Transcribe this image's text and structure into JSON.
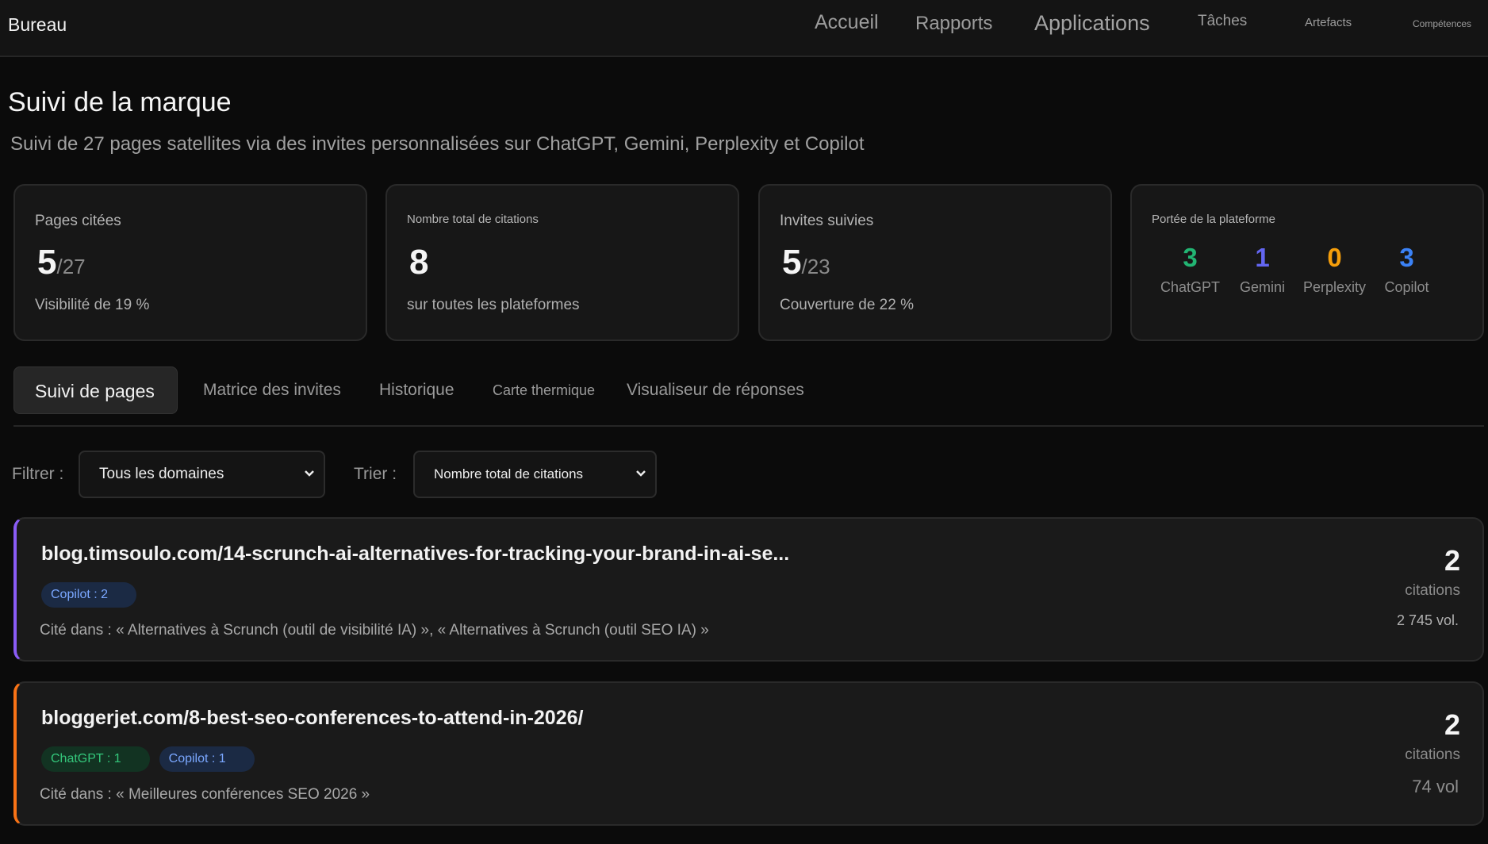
{
  "header": {
    "brand": "Bureau",
    "nav": [
      "Accueil",
      "Rapports",
      "Applications",
      "Tâches",
      "Artefacts",
      "Compétences"
    ]
  },
  "page": {
    "title": "Suivi de la marque",
    "subtitle": "Suivi de 27 pages satellites via des invites personnalisées sur ChatGPT, Gemini, Perplexity et Copilot"
  },
  "stats": {
    "pages": {
      "label": "Pages citées",
      "value": "5",
      "denom": "/27",
      "sub": "Visibilité de 19 %"
    },
    "citations": {
      "label": "Nombre total de citations",
      "value": "8",
      "sub": "sur toutes les plateformes"
    },
    "prompts": {
      "label": "Invites suivies",
      "value": "5",
      "denom": "/23",
      "sub": "Couverture de 22 %"
    },
    "reach": {
      "label": "Portée de la plateforme",
      "platforms": [
        {
          "name": "ChatGPT",
          "count": "3",
          "color": "#22b573"
        },
        {
          "name": "Gemini",
          "count": "1",
          "color": "#6366f1"
        },
        {
          "name": "Perplexity",
          "count": "0",
          "color": "#f59e0b"
        },
        {
          "name": "Copilot",
          "count": "3",
          "color": "#3b82f6"
        }
      ]
    }
  },
  "tabs": [
    "Suivi de pages",
    "Matrice des invites",
    "Historique",
    "Carte thermique",
    "Visualiseur de réponses"
  ],
  "filters": {
    "filter_label": "Filtrer :",
    "filter_value": "Tous les domaines",
    "sort_label": "Trier :",
    "sort_value": "Nombre total de citations"
  },
  "results": [
    {
      "url": "blog.timsoulo.com/14-scrunch-ai-alternatives-for-tracking-your-brand-in-ai-se...",
      "badges": [
        {
          "label": "Copilot : 2",
          "kind": "copilot"
        }
      ],
      "cited": "Cité dans : « Alternatives à Scrunch (outil de visibilité IA) », « Alternatives à Scrunch (outil SEO IA) »",
      "count": "2",
      "count_label": "citations",
      "volume": "2 745 vol."
    },
    {
      "url": "bloggerjet.com/8-best-seo-conferences-to-attend-in-2026/",
      "badges": [
        {
          "label": "ChatGPT : 1",
          "kind": "chatgpt"
        },
        {
          "label": "Copilot : 1",
          "kind": "copilot"
        }
      ],
      "cited": "Cité dans : « Meilleures conférences SEO 2026 »",
      "count": "2",
      "count_label": "citations",
      "volume": "74 vol"
    }
  ]
}
